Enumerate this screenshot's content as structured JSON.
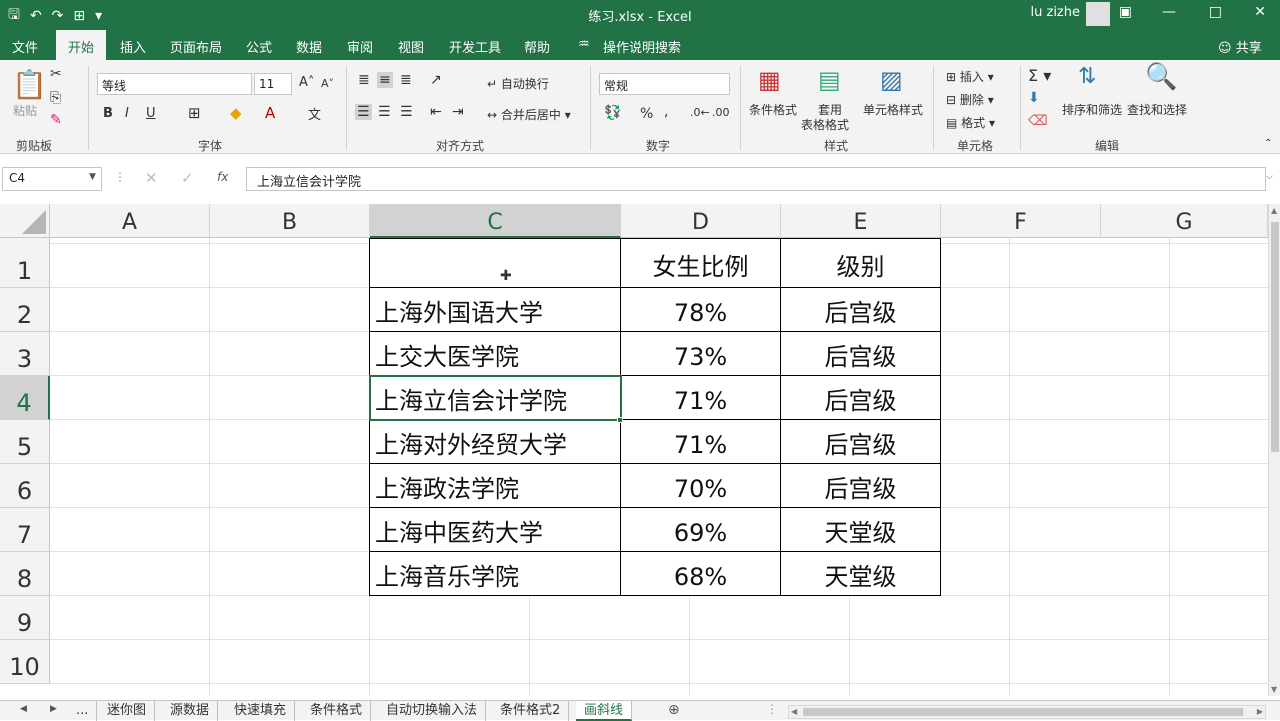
{
  "window": {
    "title": "练习.xlsx  -  Excel",
    "user": "lu zizhe"
  },
  "ribbon_tabs": [
    "文件",
    "开始",
    "插入",
    "页面布局",
    "公式",
    "数据",
    "审阅",
    "视图",
    "开发工具",
    "帮助",
    "操作说明搜索",
    "共享"
  ],
  "active_tab": "开始",
  "ribbon": {
    "clipboard": {
      "paste": "粘贴",
      "label": "剪贴板"
    },
    "font": {
      "name": "等线",
      "size": "11",
      "bold": "B",
      "italic": "I",
      "underline": "U",
      "label": "字体"
    },
    "alignment": {
      "wrap": "自动换行",
      "merge": "合并后居中",
      "label": "对齐方式"
    },
    "number": {
      "format": "常规",
      "percent": "%",
      "comma": ",",
      "label": "数字"
    },
    "styles": {
      "conditional": "条件格式",
      "table1": "套用",
      "table2": "表格格式",
      "cell_styles": "单元格样式",
      "label": "样式"
    },
    "cells": {
      "insert": "插入",
      "delete": "删除",
      "format": "格式",
      "label": "单元格"
    },
    "editing": {
      "sort": "排序和筛选",
      "find": "查找和选择",
      "label": "编辑"
    }
  },
  "formula_bar": {
    "name_box": "C4",
    "fx": "fx",
    "content": "上海立信会计学院"
  },
  "columns": [
    "A",
    "B",
    "C",
    "D",
    "E",
    "F",
    "G"
  ],
  "rows": [
    "1",
    "2",
    "3",
    "4",
    "5",
    "6",
    "7",
    "8",
    "9",
    "10"
  ],
  "selected": {
    "column": "C",
    "row": "4"
  },
  "table": {
    "header": {
      "c": "",
      "d": "女生比例",
      "e": "级别"
    },
    "rows": [
      {
        "c": "上海外国语大学",
        "d": "78%",
        "e": "后宫级"
      },
      {
        "c": "上交大医学院",
        "d": "73%",
        "e": "后宫级"
      },
      {
        "c": "上海立信会计学院",
        "d": "71%",
        "e": "后宫级"
      },
      {
        "c": "上海对外经贸大学",
        "d": "71%",
        "e": "后宫级"
      },
      {
        "c": "上海政法学院",
        "d": "70%",
        "e": "后宫级"
      },
      {
        "c": "上海中医药大学",
        "d": "69%",
        "e": "天堂级"
      },
      {
        "c": "上海音乐学院",
        "d": "68%",
        "e": "天堂级"
      }
    ]
  },
  "sheet_tabs": [
    "...",
    "迷你图",
    "源数据",
    "快速填充",
    "条件格式",
    "自动切换输入法",
    "条件格式2",
    "画斜线"
  ],
  "active_sheet": "画斜线",
  "colors": {
    "accent": "#217346"
  }
}
